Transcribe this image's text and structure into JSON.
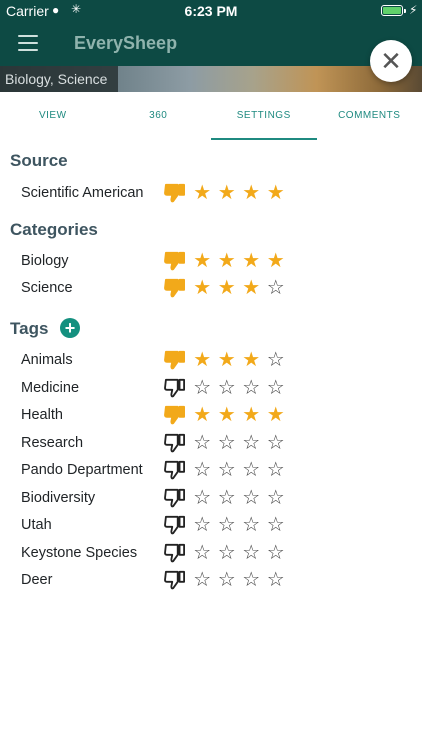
{
  "status_bar": {
    "carrier": "Carrier",
    "time": "6:23 PM"
  },
  "app": {
    "title": "EverySheep"
  },
  "image_strip": {
    "label": "Biology, Science"
  },
  "tabs": [
    {
      "label": "VIEW",
      "active": false
    },
    {
      "label": "360",
      "active": false
    },
    {
      "label": "SETTINGS",
      "active": true
    },
    {
      "label": "COMMENTS",
      "active": false
    }
  ],
  "sections": {
    "source": {
      "title": "Source",
      "items": [
        {
          "label": "Scientific American",
          "rating": 4,
          "disliked": true
        }
      ]
    },
    "categories": {
      "title": "Categories",
      "items": [
        {
          "label": "Biology",
          "rating": 4,
          "disliked": true
        },
        {
          "label": "Science",
          "rating": 3,
          "disliked": true
        }
      ]
    },
    "tags": {
      "title": "Tags",
      "add_icon": "plus-circle-icon",
      "items": [
        {
          "label": "Animals",
          "rating": 3,
          "disliked": true
        },
        {
          "label": "Medicine",
          "rating": 0,
          "disliked": false
        },
        {
          "label": "Health",
          "rating": 4,
          "disliked": true
        },
        {
          "label": "Research",
          "rating": 0,
          "disliked": false
        },
        {
          "label": "Pando Department",
          "rating": 0,
          "disliked": false
        },
        {
          "label": "Biodiversity",
          "rating": 0,
          "disliked": false
        },
        {
          "label": "Utah",
          "rating": 0,
          "disliked": false
        },
        {
          "label": "Keystone Species",
          "rating": 0,
          "disliked": false
        },
        {
          "label": "Deer",
          "rating": 0,
          "disliked": false
        }
      ]
    }
  },
  "colors": {
    "header": "#0d4a44",
    "accent": "#1f8a80",
    "star_on": "#f2a91a",
    "add_button": "#14907f"
  }
}
